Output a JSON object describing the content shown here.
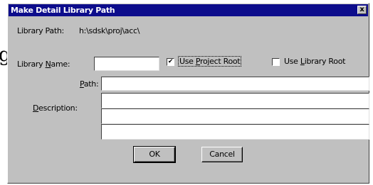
{
  "dialog": {
    "title": "Make Detail Library Path",
    "close_glyph": "x",
    "library_path_label": "Library Path:",
    "library_path_value": "h:\\sdsk\\proj\\acc\\",
    "library_name": {
      "label_pre": "Library ",
      "label_acc": "N",
      "label_post": "ame:",
      "value": ""
    },
    "use_project_root": {
      "label_pre": "Use ",
      "label_acc": "P",
      "label_post": "roject Root",
      "checked": true,
      "mark": "✔"
    },
    "use_library_root": {
      "label_pre": "Use ",
      "label_acc": "L",
      "label_post": "ibrary Root",
      "checked": false
    },
    "path": {
      "label_acc": "P",
      "label_post": "ath:",
      "value": ""
    },
    "description": {
      "label_acc": "D",
      "label_post": "escription:",
      "line1": "",
      "line2": "",
      "line3": ""
    },
    "buttons": {
      "ok": "OK",
      "cancel": "Cancel"
    }
  },
  "background": {
    "partial_letter": "g"
  }
}
